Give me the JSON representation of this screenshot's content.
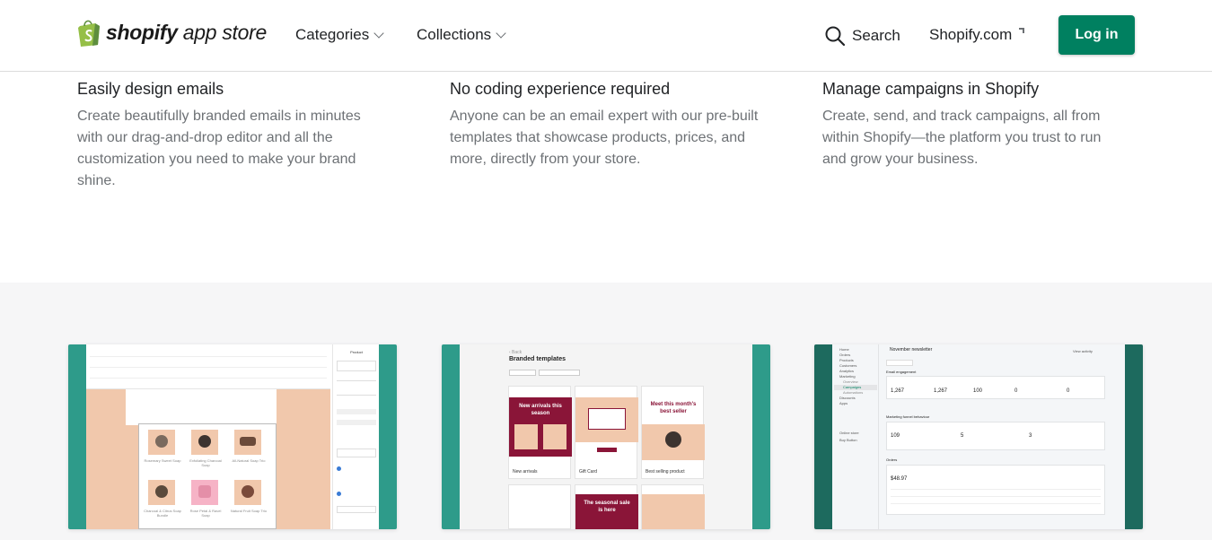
{
  "header": {
    "logo_bold": "shopify",
    "logo_light": " app store",
    "nav": [
      {
        "label": "Categories"
      },
      {
        "label": "Collections"
      }
    ],
    "search_label": "Search",
    "shopify_com_label": "Shopify.com",
    "login_label": "Log in"
  },
  "features": [
    {
      "title": "Easily design emails",
      "body": "Create beautifully branded emails in minutes with our drag-and-drop editor and all the customization you need to make your brand shine."
    },
    {
      "title": "No coding experience required",
      "body": "Anyone can be an email expert with our pre-built templates that showcase products, prices, and more, directly from your store."
    },
    {
      "title": "Manage campaigns in Shopify",
      "body": "Create, send, and track campaigns, all from within Shopify—the platform you trust to run and grow your business."
    }
  ],
  "screenshots": {
    "editor": {
      "panel_title": "Product",
      "products": [
        "Rosemary Sweet Soap",
        "Exfoliating Charcoal Soap",
        "All-Natural Soap Trio",
        "Charcoal & Citrus Soap Bundle",
        "Rose Petal & Ravel Soap",
        "Natural Fruit Soap Trio"
      ]
    },
    "templates": {
      "title": "Branded templates",
      "cards": [
        {
          "label": "New arrivals",
          "hero": "New arrivals this season"
        },
        {
          "label": "Gift Card",
          "hero": ""
        },
        {
          "label": "Best selling product",
          "hero": "Meet this month's best seller"
        }
      ],
      "row2_hero": "The seasonal sale is here"
    },
    "campaign": {
      "title": "November newsletter",
      "view_activity": "View activity",
      "section_engagement": "Email engagement",
      "engagement_values": [
        "1,267",
        "1,267",
        "100",
        "0",
        "0"
      ],
      "section_funnel": "Marketing funnel behaviour",
      "funnel_values": [
        "109",
        "5",
        "3"
      ],
      "section_orders": "Orders",
      "sales": "$48.97",
      "sidebar": [
        "Home",
        "Orders",
        "Products",
        "Customers",
        "Analytics",
        "Marketing",
        "Overview",
        "Campaigns",
        "Automations",
        "Discounts",
        "Apps",
        "Online store",
        "Buy Button"
      ]
    }
  },
  "colors": {
    "login_bg": "#008060",
    "teal": "#2e9b8a",
    "maroon": "#8a1538",
    "peach": "#f1c8ac",
    "gallery_bg": "#f6f6f7"
  }
}
